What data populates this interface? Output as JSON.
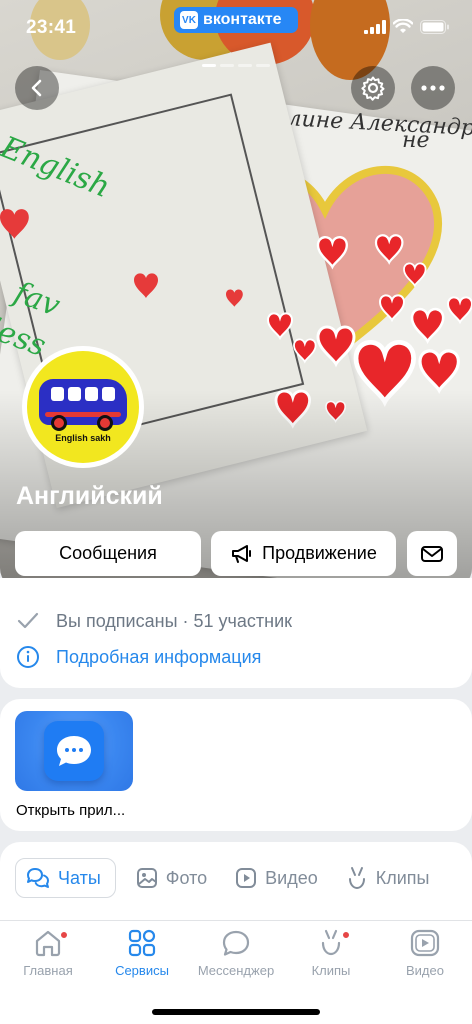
{
  "status_bar": {
    "time": "23:41",
    "app_pill": "вконтакте"
  },
  "cover_handwriting": {
    "line1": "бимой Ангелине Александро",
    "line2": "не",
    "green1": "English",
    "green2": "fav",
    "green3": "less"
  },
  "avatar": {
    "caption": "English sakh"
  },
  "group": {
    "name": "Английский"
  },
  "actions": {
    "messages": "Сообщения",
    "promotion": "Продвижение"
  },
  "info": {
    "subscribed": "Вы подписаны",
    "separator": " · ",
    "members": "51 участник",
    "details": "Подробная информация"
  },
  "app_widget": {
    "caption": "Открыть прил..."
  },
  "tabs": [
    {
      "label": "Чаты",
      "icon": "chats-icon",
      "active": true
    },
    {
      "label": "Фото",
      "icon": "photo-icon",
      "active": false
    },
    {
      "label": "Видео",
      "icon": "video-icon",
      "active": false
    },
    {
      "label": "Клипы",
      "icon": "clips-icon",
      "active": false
    }
  ],
  "bottom_nav": [
    {
      "label": "Главная",
      "icon": "home-icon",
      "badge": true
    },
    {
      "label": "Сервисы",
      "icon": "services-icon",
      "active": true
    },
    {
      "label": "Мессенджер",
      "icon": "messenger-icon"
    },
    {
      "label": "Клипы",
      "icon": "clips-icon",
      "badge": true
    },
    {
      "label": "Видео",
      "icon": "video-icon"
    }
  ],
  "colors": {
    "accent": "#2688eb",
    "vk_blue": "#2787f5",
    "badge": "#e64646",
    "background": "#ebedf0"
  }
}
